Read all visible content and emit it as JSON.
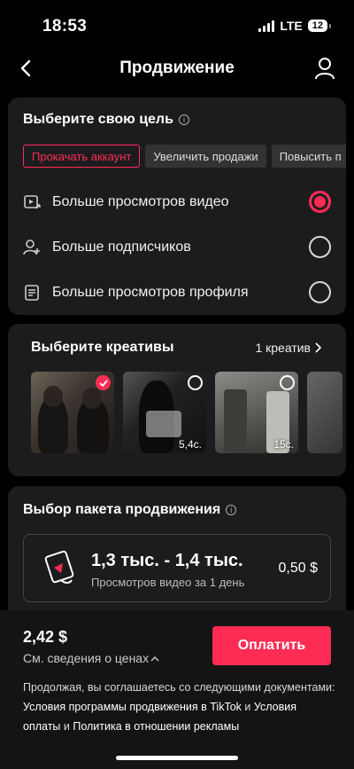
{
  "status_bar": {
    "time": "18:53",
    "network": "LTE",
    "battery": "12"
  },
  "header": {
    "title": "Продвижение"
  },
  "goal": {
    "title": "Выберите свою цель",
    "chips": [
      "Прокачать аккаунт",
      "Увеличить продажи",
      "Повысить п"
    ],
    "active_chip": 0,
    "options": [
      {
        "label": "Больше просмотров видео",
        "icon": "video-views-icon",
        "selected": true
      },
      {
        "label": "Больше подписчиков",
        "icon": "add-follower-icon",
        "selected": false
      },
      {
        "label": "Больше просмотров профиля",
        "icon": "profile-document-icon",
        "selected": false
      }
    ]
  },
  "creatives": {
    "title": "Выберите креативы",
    "count_label": "1 креатив",
    "thumbnails": [
      {
        "duration": "",
        "selected": true
      },
      {
        "duration": "5,4с.",
        "selected": false
      },
      {
        "duration": "15с.",
        "selected": false
      },
      {
        "duration": "",
        "selected": false
      }
    ]
  },
  "package": {
    "title": "Выбор пакета продвижения",
    "range": "1,3 тыс. - 1,4 тыс.",
    "subtitle": "Просмотров видео за 1 день",
    "price": "0,50 $"
  },
  "footer": {
    "total": "2,42 $",
    "price_details": "См. сведения о ценах",
    "pay_button": "Оплатить",
    "legal_prefix": "Продолжая, вы соглашаетесь со следующими документами: ",
    "legal_link1": "Условия программы продвижения в TikTok",
    "legal_and": " и ",
    "legal_link2": "Условия оплаты",
    "legal_and2": " и ",
    "legal_link3": "Политика в отношении рекламы"
  },
  "colors": {
    "accent": "#fe2c55",
    "card": "#1c1c1e",
    "background": "#000000"
  }
}
